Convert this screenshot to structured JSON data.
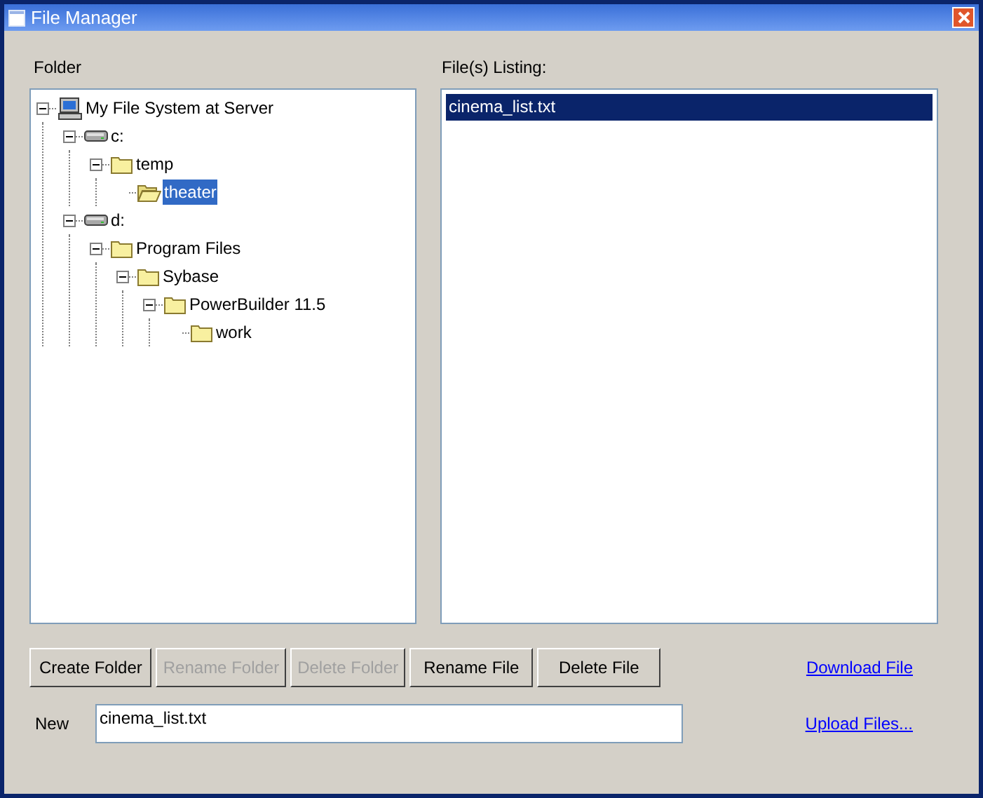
{
  "window": {
    "title": "File Manager"
  },
  "folder_panel": {
    "label": "Folder",
    "tree": [
      {
        "label": "My File System at Server",
        "kind": "computer",
        "expanded": true,
        "selected": false,
        "children": [
          {
            "label": "c:",
            "kind": "drive",
            "expanded": true,
            "selected": false,
            "children": [
              {
                "label": "temp",
                "kind": "folder",
                "expanded": true,
                "selected": false,
                "children": [
                  {
                    "label": "theater",
                    "kind": "open-folder",
                    "selected": true
                  }
                ]
              }
            ]
          },
          {
            "label": "d:",
            "kind": "drive",
            "expanded": true,
            "selected": false,
            "children": [
              {
                "label": "Program Files",
                "kind": "folder",
                "expanded": true,
                "selected": false,
                "children": [
                  {
                    "label": "Sybase",
                    "kind": "folder",
                    "expanded": true,
                    "selected": false,
                    "children": [
                      {
                        "label": "PowerBuilder 11.5",
                        "kind": "folder",
                        "expanded": true,
                        "selected": false,
                        "children": [
                          {
                            "label": "work",
                            "kind": "folder",
                            "selected": false
                          }
                        ]
                      }
                    ]
                  }
                ]
              }
            ]
          }
        ]
      }
    ]
  },
  "files_panel": {
    "label": "File(s) Listing:",
    "files": [
      {
        "name": "cinema_list.txt",
        "selected": true
      }
    ]
  },
  "buttons": [
    {
      "label": "Create Folder",
      "disabled": false
    },
    {
      "label": "Rename Folder",
      "disabled": true
    },
    {
      "label": "Delete Folder",
      "disabled": true
    },
    {
      "label": "Rename File",
      "disabled": false
    },
    {
      "label": "Delete File",
      "disabled": false
    }
  ],
  "new_name": {
    "label": "New",
    "value": "cinema_list.txt"
  },
  "links": [
    "Download File",
    "Upload Files..."
  ]
}
